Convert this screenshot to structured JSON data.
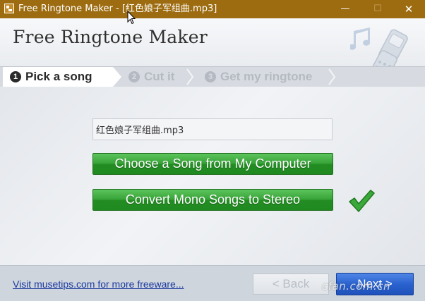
{
  "window": {
    "title": "Free Ringtone Maker - [红色娘子军组曲.mp3]",
    "minimize_glyph": "—",
    "maximize_glyph": "☐",
    "close_glyph": "✕"
  },
  "header": {
    "app_title": "Free Ringtone Maker"
  },
  "steps": [
    {
      "num": "1",
      "label": "Pick a song",
      "active": true
    },
    {
      "num": "2",
      "label": "Cut it",
      "active": false
    },
    {
      "num": "3",
      "label": "Get my ringtone",
      "active": false
    }
  ],
  "main": {
    "song_file": "红色娘子军组曲.mp3",
    "choose_button": "Choose a Song from My Computer",
    "convert_button": "Convert Mono Songs to Stereo"
  },
  "footer": {
    "link_text": "Visit musetips.com for more freeware...",
    "back_button": "< Back",
    "next_button": "Next >",
    "watermark": "cfan.com.cn"
  },
  "colors": {
    "titlebar": "#9d6c10",
    "green_button": "#37a337",
    "next_button": "#2a62cf",
    "link": "#1b3a9e"
  },
  "icons": [
    "app-icon",
    "music-note-icon",
    "phone-icon",
    "check-icon",
    "cursor-icon"
  ]
}
